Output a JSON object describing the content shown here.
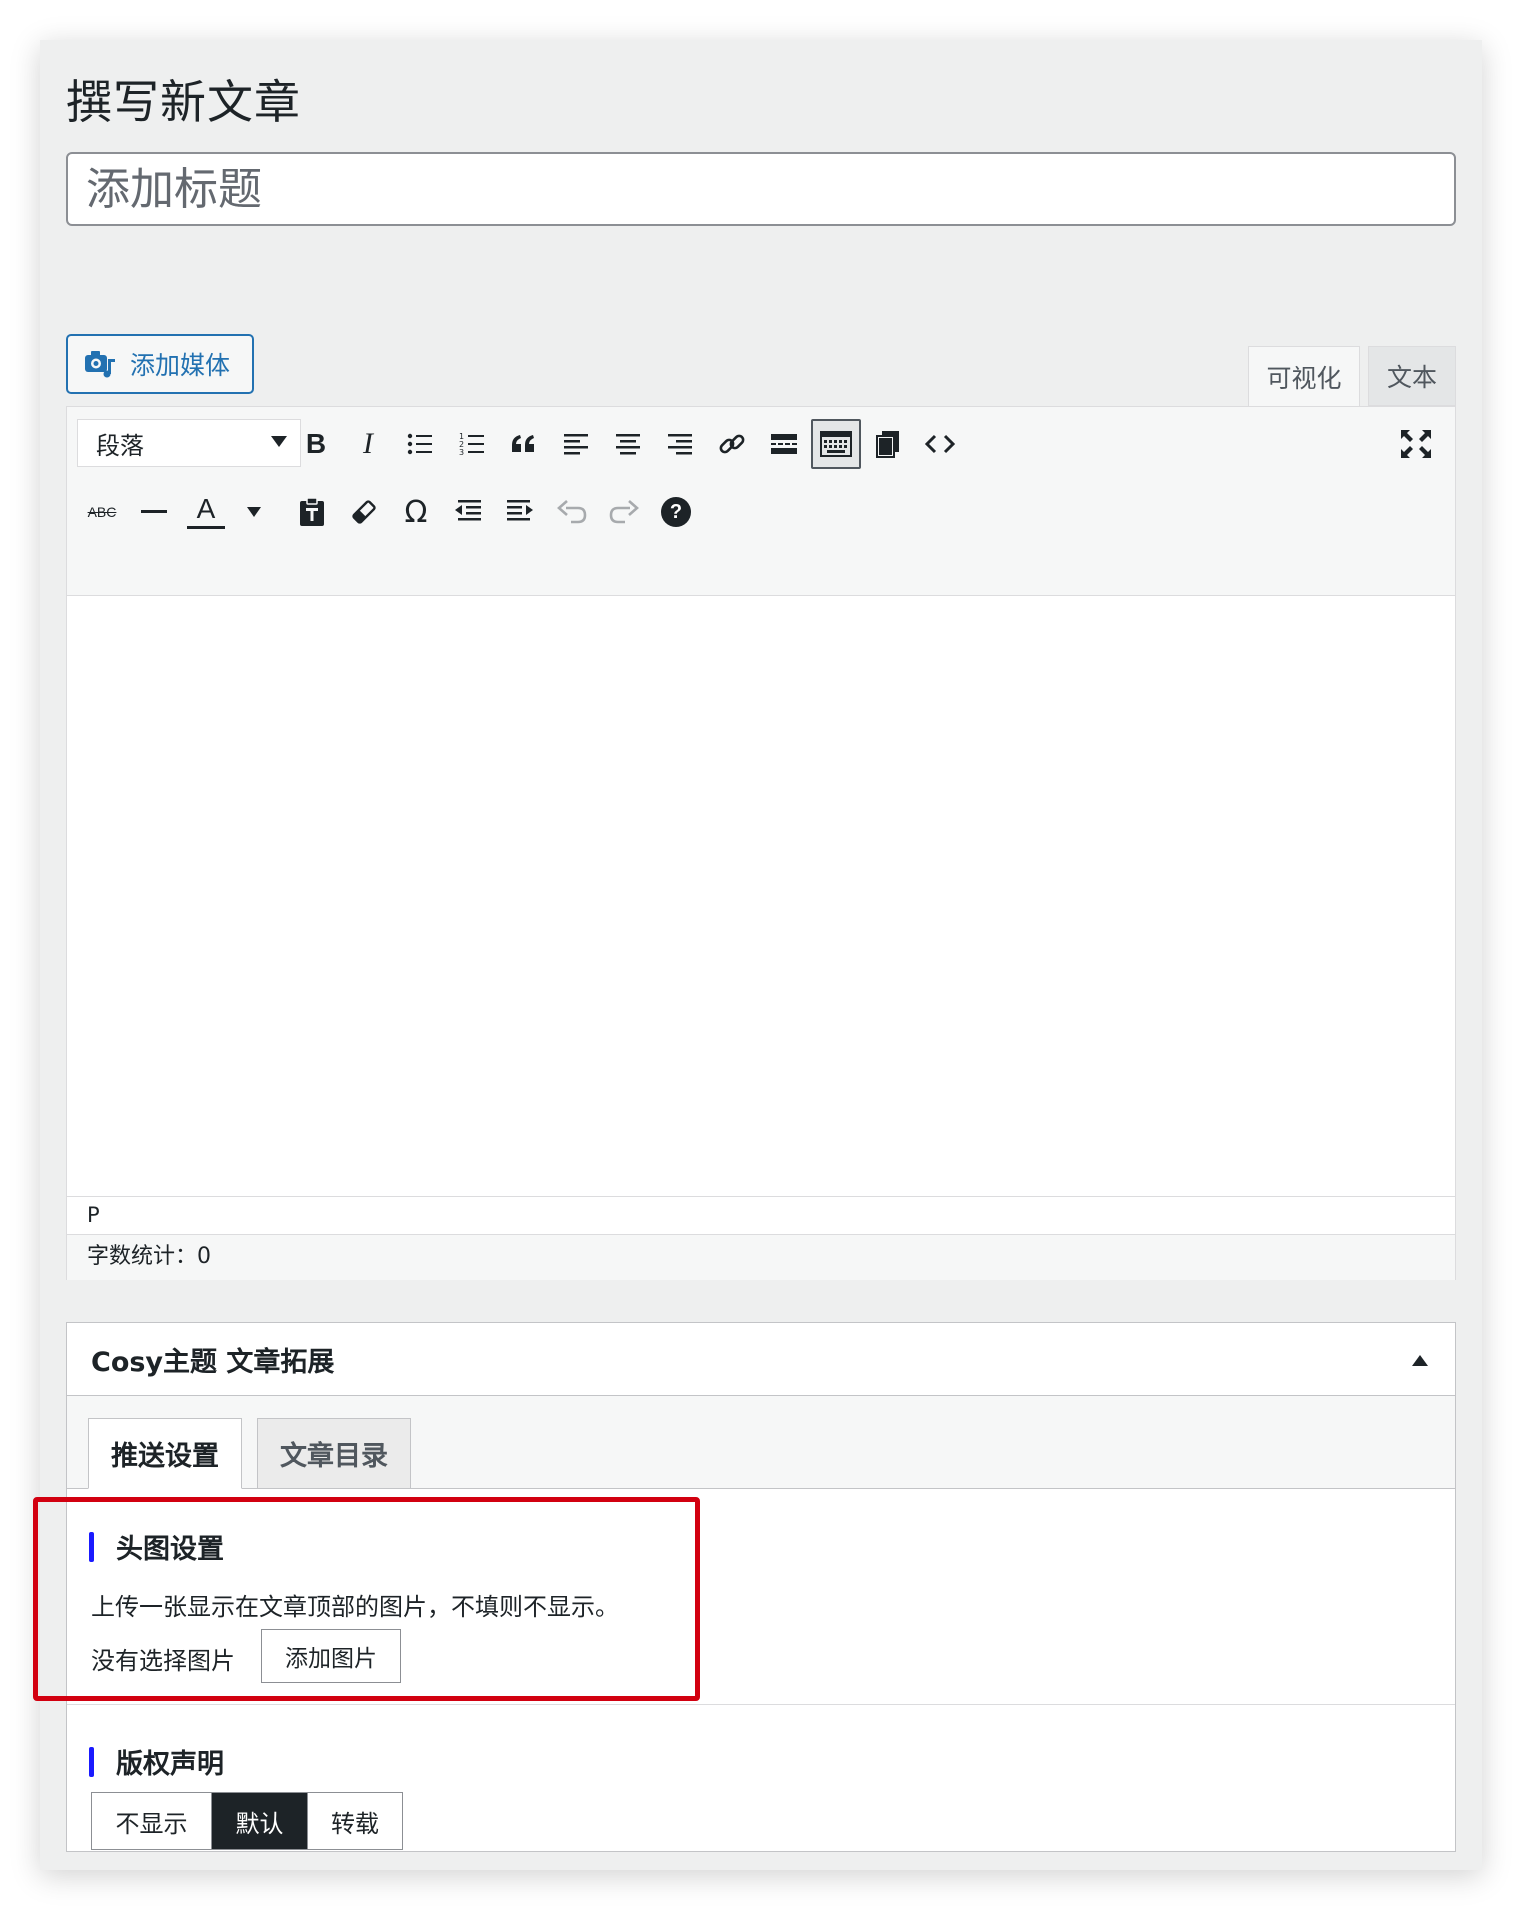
{
  "page": {
    "title": "撰写新文章"
  },
  "title_field": {
    "placeholder": "添加标题",
    "value": ""
  },
  "media": {
    "add_media_label": "添加媒体"
  },
  "editor_tabs": {
    "visual": "可视化",
    "text": "文本"
  },
  "toolbar": {
    "format_select": "段落",
    "row1_icons": [
      "bold-icon",
      "italic-icon",
      "bullet-list-icon",
      "numbered-list-icon",
      "blockquote-icon",
      "align-left-icon",
      "align-center-icon",
      "align-right-icon",
      "link-icon",
      "read-more-icon",
      "toolbar-toggle-icon",
      "paste-icon",
      "code-icon",
      "fullscreen-icon"
    ],
    "row2_icons": [
      "strikethrough-icon",
      "horizontal-line-icon",
      "text-color-icon",
      "paste-as-text-icon",
      "clear-formatting-icon",
      "special-character-icon",
      "outdent-icon",
      "indent-icon",
      "undo-icon",
      "redo-icon",
      "help-icon"
    ],
    "bold_glyph": "B",
    "italic_glyph": "I",
    "strike_glyph": "ABC",
    "text_color_glyph": "A",
    "omega_glyph": "Ω",
    "help_glyph": "?"
  },
  "editor": {
    "path": "P",
    "word_count_label": "字数统计：",
    "word_count": "0"
  },
  "metabox": {
    "title": "Cosy主题 文章拓展",
    "tabs": [
      "推送设置",
      "文章目录"
    ],
    "header_image": {
      "heading": "头图设置",
      "description": "上传一张显示在文章顶部的图片，不填则不显示。",
      "status": "没有选择图片",
      "button": "添加图片"
    },
    "copyright": {
      "heading": "版权声明",
      "options": [
        "不显示",
        "默认",
        "转载"
      ],
      "selected": "默认"
    }
  },
  "colors": {
    "accent": "#2271b1",
    "highlight_box": "#d20010",
    "section_bar": "#1a1aff",
    "selected_option_bg": "#1d2327"
  }
}
